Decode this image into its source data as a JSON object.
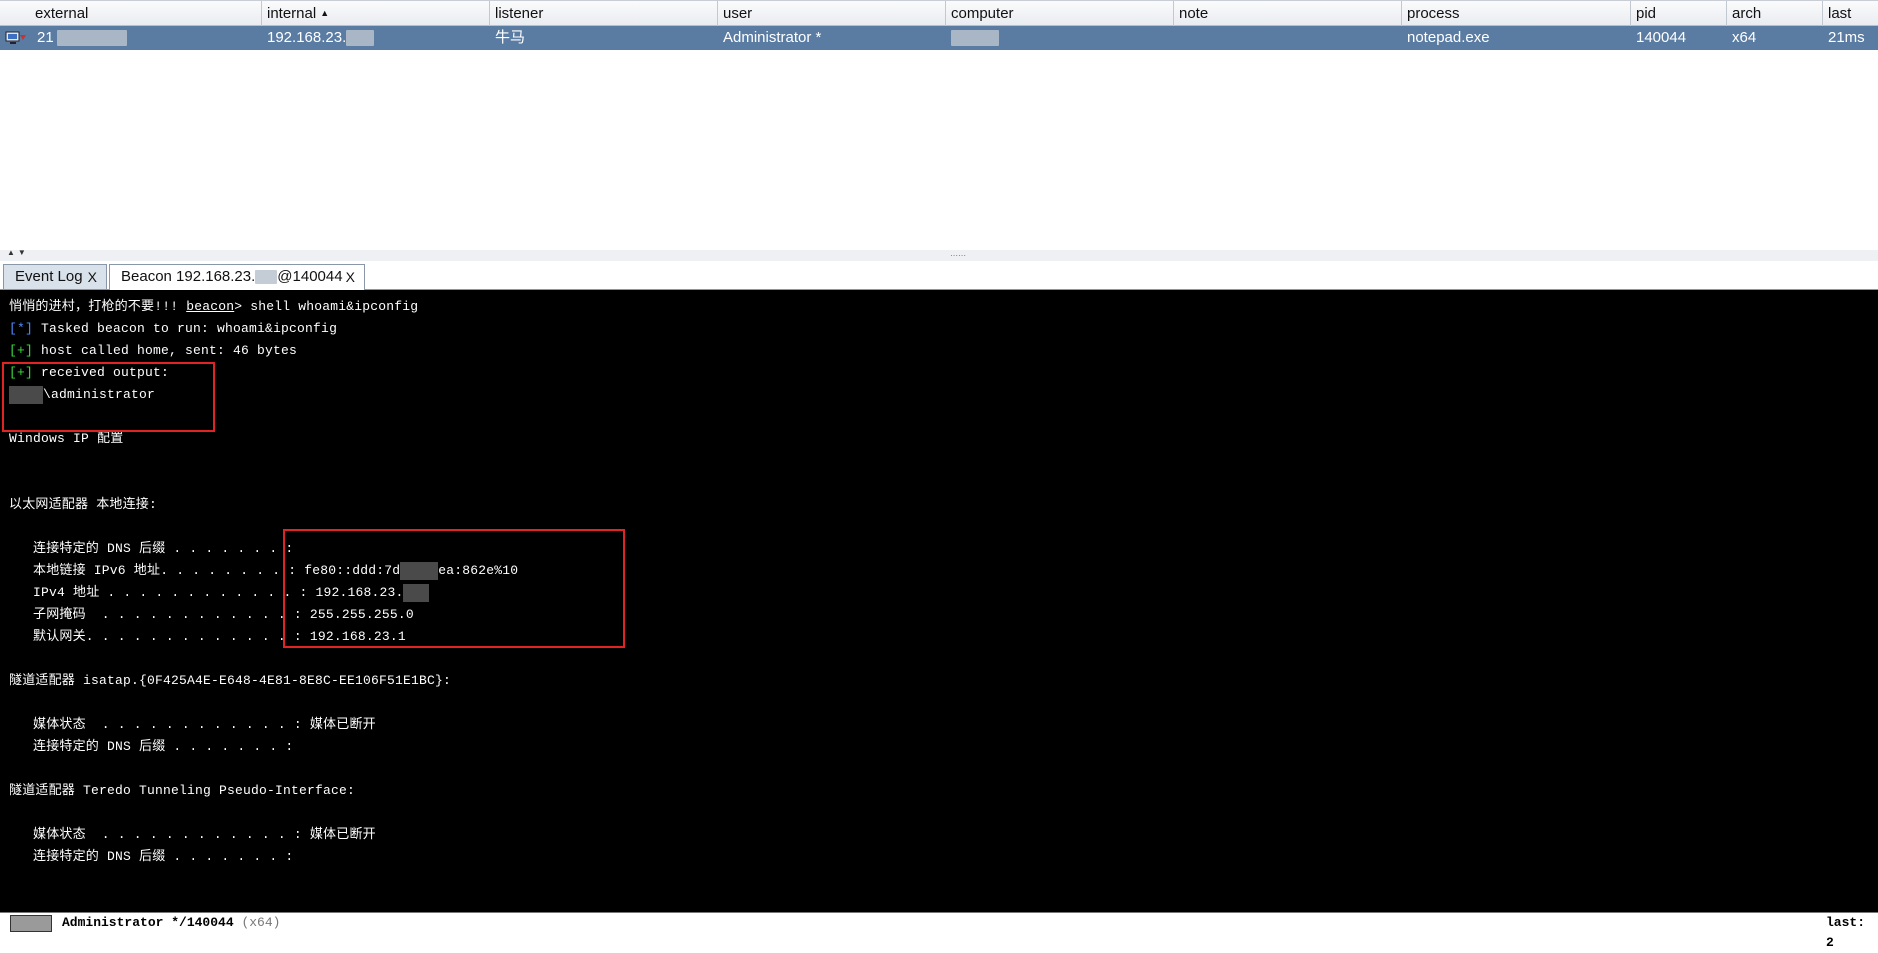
{
  "table": {
    "columns": [
      {
        "label": "external"
      },
      {
        "label": "internal",
        "sort": "▲"
      },
      {
        "label": "listener"
      },
      {
        "label": "user"
      },
      {
        "label": "computer"
      },
      {
        "label": "note"
      },
      {
        "label": "process"
      },
      {
        "label": "pid"
      },
      {
        "label": "arch"
      },
      {
        "label": "last"
      }
    ],
    "row": {
      "external": "21",
      "internal": "192.168.23.",
      "listener": "牛马",
      "user": "Administrator *",
      "computer": "",
      "note": "",
      "process": "notepad.exe",
      "pid": "140044",
      "arch": "x64",
      "last": "21ms"
    }
  },
  "tabs": [
    {
      "label": "Event Log",
      "close": "X"
    },
    {
      "label": "Beacon 192.168.23.",
      "label_suffix": "@140044",
      "close": "X"
    }
  ],
  "console": {
    "prompt_prefix": "悄悄的进村，打枪的不要!!! ",
    "prompt_name": "beacon",
    "prompt_cmd": "> shell whoami&ipconfig",
    "l_tasked_marker": "[*]",
    "l_tasked_text": " Tasked beacon to run: whoami&ipconfig",
    "l_sent_marker": "[+]",
    "l_sent_text": " host called home, sent: 46 bytes",
    "l_recv_marker": "[+]",
    "l_recv_text": " received output:",
    "l_user": "\\administrator",
    "l_winip": "Windows IP 配置",
    "l_eth": "以太网适配器 本地连接:",
    "l_dns1": "   连接特定的 DNS 后缀 . . . . . . . :",
    "l_ipv6_pre": "   本地链接 IPv6 地址. . . . . . . . : fe80::ddd:7d",
    "l_ipv6_post": "ea:862e%10",
    "l_ipv4_pre": "   IPv4 地址 . . . . . . . . . . . . : 192.168.23.",
    "l_mask": "   子网掩码  . . . . . . . . . . . . : 255.255.255.0",
    "l_gw": "   默认网关. . . . . . . . . . . . . : 192.168.23.1",
    "l_isatap": "隧道适配器 isatap.{0F425A4E-E648-4E81-8E8C-EE106F51E1BC}:",
    "l_media1": "   媒体状态  . . . . . . . . . . . . : 媒体已断开",
    "l_dns2": "   连接特定的 DNS 后缀 . . . . . . . :",
    "l_teredo": "隧道适配器 Teredo Tunneling Pseudo-Interface:",
    "l_media2": "   媒体状态  . . . . . . . . . . . . : 媒体已断开",
    "l_dns3": "   连接特定的 DNS 后缀 . . . . . . . :"
  },
  "status": {
    "user_pid": "Administrator */140044",
    "arch": "(x64)",
    "last": "last: 2"
  },
  "colors": {
    "row_selected": "#5a7ca3",
    "console_bg": "#000000",
    "ok_green": "#3ddc3d",
    "info_blue": "#4f8cff",
    "annotation_red": "#e02424"
  },
  "icons": {
    "session": "computer-session-icon",
    "sort": "sort-ascending-icon",
    "tab_close": "close-icon"
  }
}
